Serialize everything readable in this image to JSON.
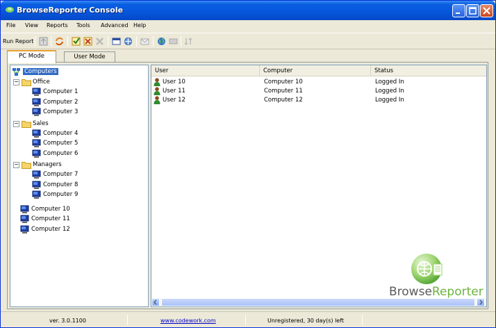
{
  "window": {
    "title": "BrowseReporter Console"
  },
  "menu": [
    "File",
    "View",
    "Reports",
    "Tools",
    "Advanced",
    "Help"
  ],
  "toolbar": {
    "run_report": "Run Report"
  },
  "tabs": [
    {
      "label": "PC Mode",
      "active": true
    },
    {
      "label": "User Mode",
      "active": false
    }
  ],
  "tree": {
    "root": "Computers",
    "groups": [
      {
        "name": "Office",
        "computers": [
          "Computer 1",
          "Computer 2",
          "Computer 3"
        ]
      },
      {
        "name": "Sales",
        "computers": [
          "Computer 4",
          "Computer 5",
          "Computer 6"
        ]
      },
      {
        "name": "Managers",
        "computers": [
          "Computer 7",
          "Computer 8",
          "Computer 9"
        ]
      }
    ],
    "ungrouped": [
      "Computer 10",
      "Computer 11",
      "Computer 12"
    ]
  },
  "list": {
    "columns": [
      "User",
      "Computer",
      "Status"
    ],
    "rows": [
      {
        "user": "User 10",
        "computer": "Computer 10",
        "status": "Logged In"
      },
      {
        "user": "User 11",
        "computer": "Computer 11",
        "status": "Logged In"
      },
      {
        "user": "User 12",
        "computer": "Computer 12",
        "status": "Logged In"
      }
    ]
  },
  "logo": {
    "part1": "Browse",
    "part2": "Reporter",
    "color1": "#5a5a5a",
    "color2": "#6db33f"
  },
  "status": {
    "version": "ver. 3.0.1100",
    "link": "www.codework.com",
    "license": "Unregistered, 30 day(s) left"
  },
  "icons": [
    "app-icon",
    "minimize-icon",
    "maximize-icon",
    "close-icon",
    "folder-icon",
    "computer-icon",
    "user-icon",
    "network-icon",
    "globe-icon"
  ]
}
